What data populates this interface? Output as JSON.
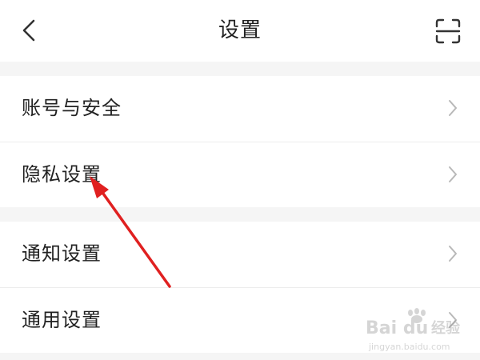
{
  "header": {
    "title": "设置",
    "back_icon": "chevron-left-icon",
    "scan_icon": "scan-icon"
  },
  "groups": [
    {
      "items": [
        {
          "label": "账号与安全",
          "icon": "chevron-right-icon"
        },
        {
          "label": "隐私设置",
          "icon": "chevron-right-icon"
        }
      ]
    },
    {
      "items": [
        {
          "label": "通知设置",
          "icon": "chevron-right-icon"
        },
        {
          "label": "通用设置",
          "icon": "chevron-right-icon"
        }
      ]
    }
  ],
  "annotation": {
    "arrow_color": "#e02020",
    "points_to": "隐私设置"
  },
  "watermark": {
    "brand": "Bai du",
    "sub": "经验",
    "url": "jingyan.baidu.com"
  },
  "colors": {
    "background": "#f5f5f5",
    "surface": "#ffffff",
    "text": "#222222",
    "chevron": "#b8b8b8"
  }
}
